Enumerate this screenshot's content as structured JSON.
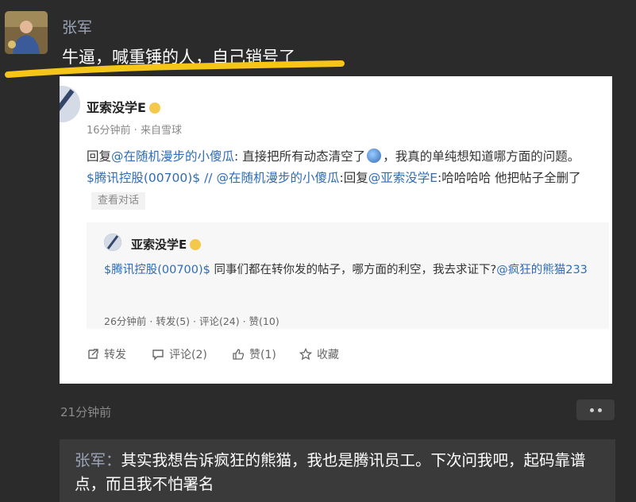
{
  "post": {
    "author": "张军",
    "text": "牛逼，喊重锤的人，自己销号了",
    "time": "21分钟前"
  },
  "embedded": {
    "author": "亚索没学E",
    "meta": "16分钟前 · 来自雪球",
    "body": {
      "reply_prefix": "回复",
      "mention1": "@在随机漫步的小傻瓜",
      "text1": ": 直接把所有动态清空了",
      "text2": "，我真的单纯想知道哪方面的问题。",
      "stock": "$腾讯控股(00700)$",
      "sep": " // ",
      "mention2": "@在随机漫步的小傻瓜",
      "text3": ":回复",
      "mention3": "@亚索没学E",
      "text4": ":哈哈哈哈 他把帖子全删了",
      "view_conversation": "查看对话"
    },
    "quote": {
      "author": "亚索没学E",
      "stock": "$腾讯控股(00700)$",
      "text": " 同事们都在转你发的帖子，哪方面的利空，我去求证下?",
      "mention": "@疯狂的熊猫233",
      "meta": "26分钟前 · 转发(5) · 评论(24) · 赞(10)"
    },
    "actions": {
      "repost": "转发",
      "comment": "评论(2)",
      "like": "赞(1)",
      "favorite": "收藏"
    }
  },
  "reply": {
    "name": "张军：",
    "text": "其实我想告诉疯狂的熊猫，我也是腾讯员工。下次问我吧，起码靠谱点，而且我不怕署名"
  },
  "colors": {
    "highlight": "#f5c518",
    "link": "#2f6cb5",
    "background": "#2b2b2b"
  }
}
